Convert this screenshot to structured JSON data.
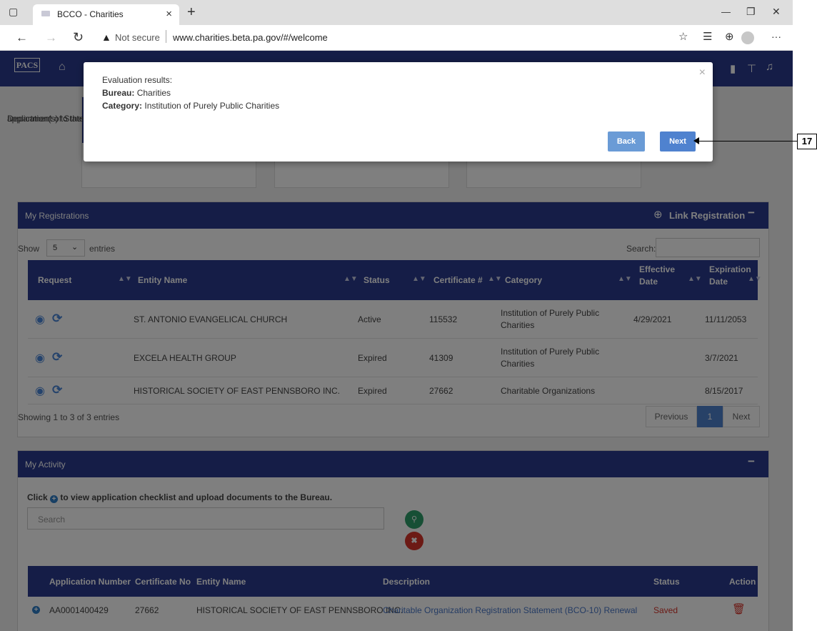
{
  "browser": {
    "tab_title": "BCCO - Charities",
    "tab_close": "×",
    "new_tab": "+",
    "not_secure": "Not secure",
    "url": "www.charities.beta.pa.gov/#/welcome",
    "window_minimize": "—",
    "window_restore": "❐",
    "window_close": "✕",
    "more": "···"
  },
  "app": {
    "logo": "PACS",
    "cards": [
      {
        "text": "Department of State."
      },
      {
        "text": "application(s) to the Bureau."
      }
    ]
  },
  "modal": {
    "heading": "Evaluation results:",
    "bureau_label": "Bureau:",
    "bureau_value": "Charities",
    "category_label": "Category:",
    "category_value": "Institution of Purely Public Charities",
    "close": "×",
    "back_label": "Back",
    "next_label": "Next"
  },
  "registrations": {
    "title": "My Registrations",
    "link_label": "Link Registration",
    "show_label": "Show",
    "entries_value": "5",
    "entries_label": "entries",
    "search_label": "Search:",
    "columns": [
      "Request",
      "Entity Name",
      "Status",
      "Certificate #",
      "Category",
      "Effective Date",
      "Expiration Date"
    ],
    "effective_l1": "Effective",
    "effective_l2": "Date",
    "expiration_l1": "Expiration",
    "expiration_l2": "Date",
    "rows": [
      {
        "entity": "ST. ANTONIO EVANGELICAL CHURCH",
        "status": "Active",
        "cert": "115532",
        "cat1": "Institution of Purely Public",
        "cat2": "Charities",
        "effective": "4/29/2021",
        "expiration": "11/11/2053"
      },
      {
        "entity": "EXCELA HEALTH GROUP",
        "status": "Expired",
        "cert": "41309",
        "cat1": "Institution of Purely Public",
        "cat2": "Charities",
        "effective": "",
        "expiration": "3/7/2021"
      },
      {
        "entity": "HISTORICAL SOCIETY OF EAST PENNSBORO INC.",
        "status": "Expired",
        "cert": "27662",
        "cat1": "Charitable Organizations",
        "cat2": "",
        "effective": "",
        "expiration": "8/15/2017"
      }
    ],
    "showing": "Showing 1 to 3 of 3 entries",
    "prev": "Previous",
    "page": "1",
    "next": "Next"
  },
  "activity": {
    "title": "My Activity",
    "instruction_pre": "Click",
    "instruction_post": "to view application checklist and upload documents to the Bureau.",
    "search_placeholder": "Search",
    "columns": [
      "Application Number",
      "Certificate No",
      "Entity Name",
      "Description",
      "Status",
      "Action"
    ],
    "rows": [
      {
        "app_no": "AA0001400429",
        "cert": "27662",
        "entity": "HISTORICAL SOCIETY OF EAST PENNSBORO INC.",
        "description": "Charitable Organization Registration Statement (BCO-10) Renewal",
        "status": "Saved"
      }
    ]
  },
  "callout": {
    "number": "17"
  },
  "colors": {
    "navy": "#2a3b8f",
    "accent": "#4f82cf",
    "saved": "#d9342b",
    "search_btn": "#2e9e6a",
    "clear_btn": "#d9342b"
  }
}
